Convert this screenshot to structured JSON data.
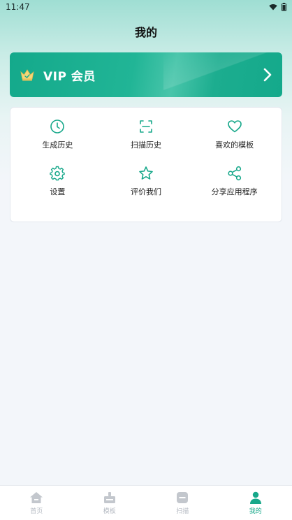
{
  "status_bar": {
    "time": "11:47"
  },
  "header": {
    "title": "我的"
  },
  "vip": {
    "label": "VIP 会员"
  },
  "menu": {
    "items": [
      {
        "label": "生成历史",
        "icon": "clock-icon"
      },
      {
        "label": "扫描历史",
        "icon": "scan-icon"
      },
      {
        "label": "喜欢的模板",
        "icon": "heart-icon"
      },
      {
        "label": "设置",
        "icon": "gear-icon"
      },
      {
        "label": "评价我们",
        "icon": "star-icon"
      },
      {
        "label": "分享应用程序",
        "icon": "share-icon"
      }
    ]
  },
  "tab_bar": {
    "tabs": [
      {
        "label": "首页",
        "icon": "home-icon",
        "active": false
      },
      {
        "label": "模板",
        "icon": "template-icon",
        "active": false
      },
      {
        "label": "扫描",
        "icon": "scan-tab-icon",
        "active": false
      },
      {
        "label": "我的",
        "icon": "person-icon",
        "active": true
      }
    ]
  },
  "colors": {
    "accent": "#17a88a",
    "vip_gradient_start": "#14a98b",
    "inactive_tab": "#b7bcc4",
    "background": "#f3f6fa"
  }
}
